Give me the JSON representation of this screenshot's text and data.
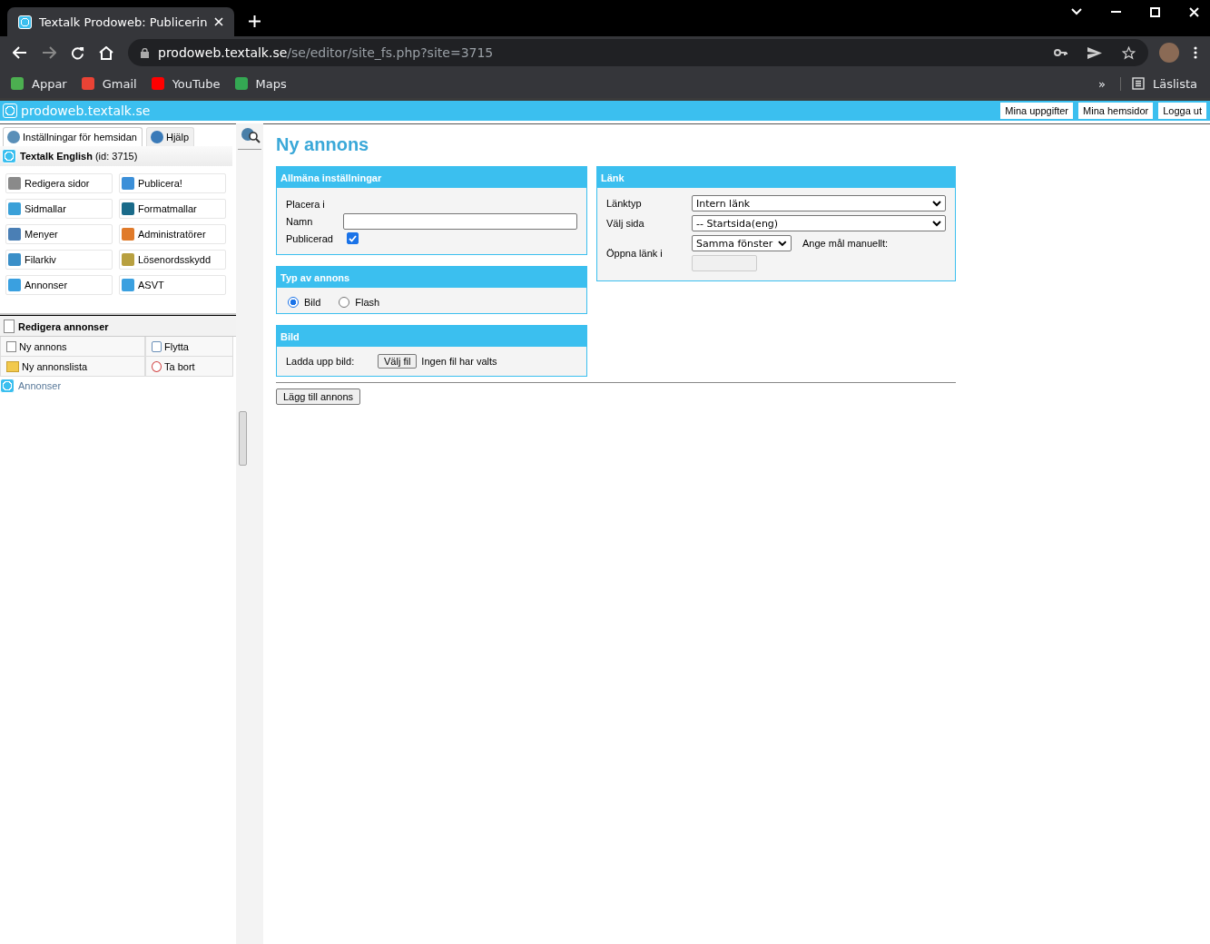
{
  "browser": {
    "tab_title": "Textalk Prodoweb: Publicerin",
    "url_host": "prodoweb.textalk.se",
    "url_path": "/se/editor/site_fs.php?site=3715",
    "bookmarks": [
      "Appar",
      "Gmail",
      "YouTube",
      "Maps"
    ],
    "overflow": "»",
    "reading_list": "Läslista"
  },
  "site_bar": {
    "title": "prodoweb.textalk.se",
    "buttons": [
      "Mina uppgifter",
      "Mina hemsidor",
      "Logga ut"
    ]
  },
  "sidebar": {
    "tabs": [
      {
        "label": "Inställningar för hemsidan",
        "selected": true
      },
      {
        "label": "Hjälp",
        "selected": false
      }
    ],
    "site": {
      "name": "Textalk English",
      "id_text": "(id: 3715)"
    },
    "tools": [
      "Redigera sidor",
      "Publicera!",
      "Sidmallar",
      "Formatmallar",
      "Menyer",
      "Administratörer",
      "Filarkiv",
      "Lösenordsskydd",
      "Annonser",
      "ASVT"
    ],
    "section_title": "Redigera annonser",
    "actions": [
      "Ny annons",
      "Flytta",
      "Ny annonslista",
      "Ta bort"
    ],
    "tree_item": "Annonser"
  },
  "main": {
    "title": "Ny annons",
    "general": {
      "title": "Allmäna inställningar",
      "place_label": "Placera i",
      "name_label": "Namn",
      "published_label": "Publicerad",
      "published": true
    },
    "ad_type": {
      "title": "Typ av annons",
      "options": [
        {
          "label": "Bild",
          "selected": true
        },
        {
          "label": "Flash",
          "selected": false
        }
      ]
    },
    "image": {
      "title": "Bild",
      "upload_label": "Ladda upp bild:",
      "choose_button": "Välj fil",
      "file_status": "Ingen fil har valts"
    },
    "link": {
      "title": "Länk",
      "type_label": "Länktyp",
      "type_value": "Intern länk",
      "page_label": "Välj sida",
      "page_value": "-- Startsida(eng)",
      "open_label": "Öppna länk i",
      "open_value": "Samma fönster",
      "manual_label": "Ange mål manuellt:",
      "manual_disabled": true
    },
    "submit": "Lägg till annons"
  }
}
